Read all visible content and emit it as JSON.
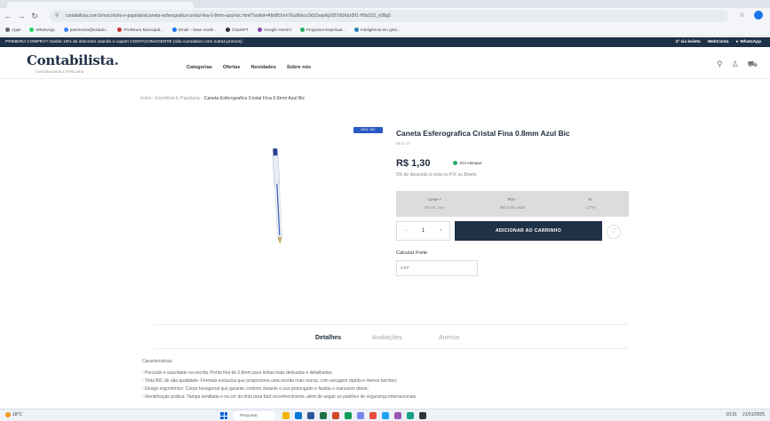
{
  "browser": {
    "url": "contabilista.com.br/escritorio-e-papelaria/caneta-esferografica-cristal-fina-0-8mm-azul-bic.html?srsltid=AfmBOorn7Eu9bbcx2k5ZwqeEjXB7dUKkz091-H9s533_s0Bg5",
    "nav": {
      "back": "←",
      "forward": "→",
      "reload": "↻"
    },
    "star": "☆"
  },
  "bookmarks": [
    {
      "label": "Apps",
      "color": "#5f6368"
    },
    {
      "label": "WhatsApp",
      "color": "#25d366"
    },
    {
      "label": "patrimonio@estado...",
      "color": "#4285f4"
    },
    {
      "label": "Prefeitura Municipal...",
      "color": "#c0392b"
    },
    {
      "label": "Email – base mode...",
      "color": "#1a73e8"
    },
    {
      "label": "ChatGPT",
      "color": "#333333"
    },
    {
      "label": "Google Gemini",
      "color": "#8e44ad"
    },
    {
      "label": "Programa Espiritual...",
      "color": "#27ae60"
    },
    {
      "label": "Inteligência em gest...",
      "color": "#2980b9"
    }
  ],
  "promo": {
    "text": "PRIMEIRA COMPRA? Ganhe 10% de desconto usando o cupom CONTACOMAGENTE (não cumulativo com outras promos)",
    "links": [
      "2ª via boleto",
      "WebConta",
      "WhatsApp"
    ]
  },
  "header": {
    "logo": "Contabilista.",
    "logo_sub": "CONTABILIDADE & PAPELARIA",
    "nav": [
      "Categorias",
      "Ofertas",
      "Novidades",
      "Sobre nós"
    ],
    "icons": [
      "search-icon",
      "user-icon",
      "cart-icon"
    ]
  },
  "breadcrumb": {
    "items": [
      "Início",
      "Escritório E Papelaria"
    ],
    "separator": "›",
    "current": "Caneta Esferografica Cristal Fina 0.8mm Azul Bic"
  },
  "product": {
    "badge": "AZUL · BIC",
    "title": "Caneta Esferografica Cristal Fina 0.8mm Azul Bic",
    "sku": "SKU: 07",
    "price": "R$ 1,30",
    "stock": "Em estoque",
    "discount_note": "5% de desconto à vista no PIX ou Boleto",
    "tiers": [
      {
        "header": "Leve +",
        "value": "50 un. ou+"
      },
      {
        "header": "Por -",
        "value": "R$ 0,95 cada"
      },
      {
        "header": "%",
        "value": "- 27%"
      }
    ],
    "quantity": "1",
    "qty_minus": "−",
    "qty_plus": "+",
    "add_to_cart": "ADICIONAR AO CARRINHO",
    "favorite": "♡",
    "shipping_label": "Calcular Frete",
    "cep_placeholder": "CEP"
  },
  "tabs": [
    "Detalhes",
    "Avaliações",
    "Anexos"
  ],
  "description": {
    "heading": "Características:",
    "bullets": [
      "- Precisão e suavidade na escrita: Ponta fina de 0,8mm para linhas mais delicadas e detalhadas;",
      "- Tinta BIC de alta qualidade: Fórmula exclusiva que proporciona uma escrita mais macia, com secagem rápida e menos borrões;",
      "- Design ergonômico: Corpo hexagonal que garante conforto durante o uso prolongado e facilita o manuseio diário;",
      "- Identificação prática: Tampa ventilada e na cor da tinta para fácil reconhecimento, além de seguir os padrões de segurança internacionais."
    ]
  },
  "taskbar": {
    "weather": "18°C",
    "search_placeholder": "Pesquisar",
    "time": "10:31",
    "date": "21/01/2025"
  }
}
